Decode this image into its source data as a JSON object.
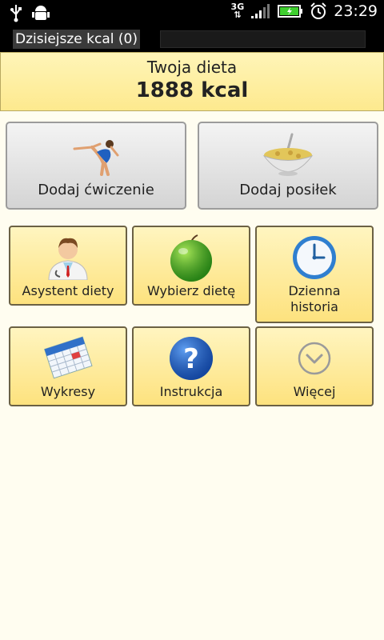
{
  "status_bar": {
    "time": "23:29",
    "network": "3G",
    "icons": [
      "usb-icon",
      "android-debug-icon",
      "signal-icon",
      "battery-icon",
      "alarm-icon"
    ]
  },
  "title_bar": {
    "title": "Dzisiejsze kcal (0)"
  },
  "diet": {
    "label": "Twoja dieta",
    "value": "1888 kcal"
  },
  "big_buttons": {
    "exercise": "Dodaj ćwiczenie",
    "meal": "Dodaj posiłek"
  },
  "tiles": {
    "assistant": "Asystent diety",
    "choose": "Wybierz dietę",
    "history_line1": "Dzienna",
    "history_line2": "historia",
    "charts": "Wykresy",
    "instructions": "Instrukcja",
    "more": "Więcej"
  },
  "colors": {
    "tile_bg": "#fde98e",
    "header_bg": "#fff5b8",
    "page_bg": "#fffdf0"
  }
}
